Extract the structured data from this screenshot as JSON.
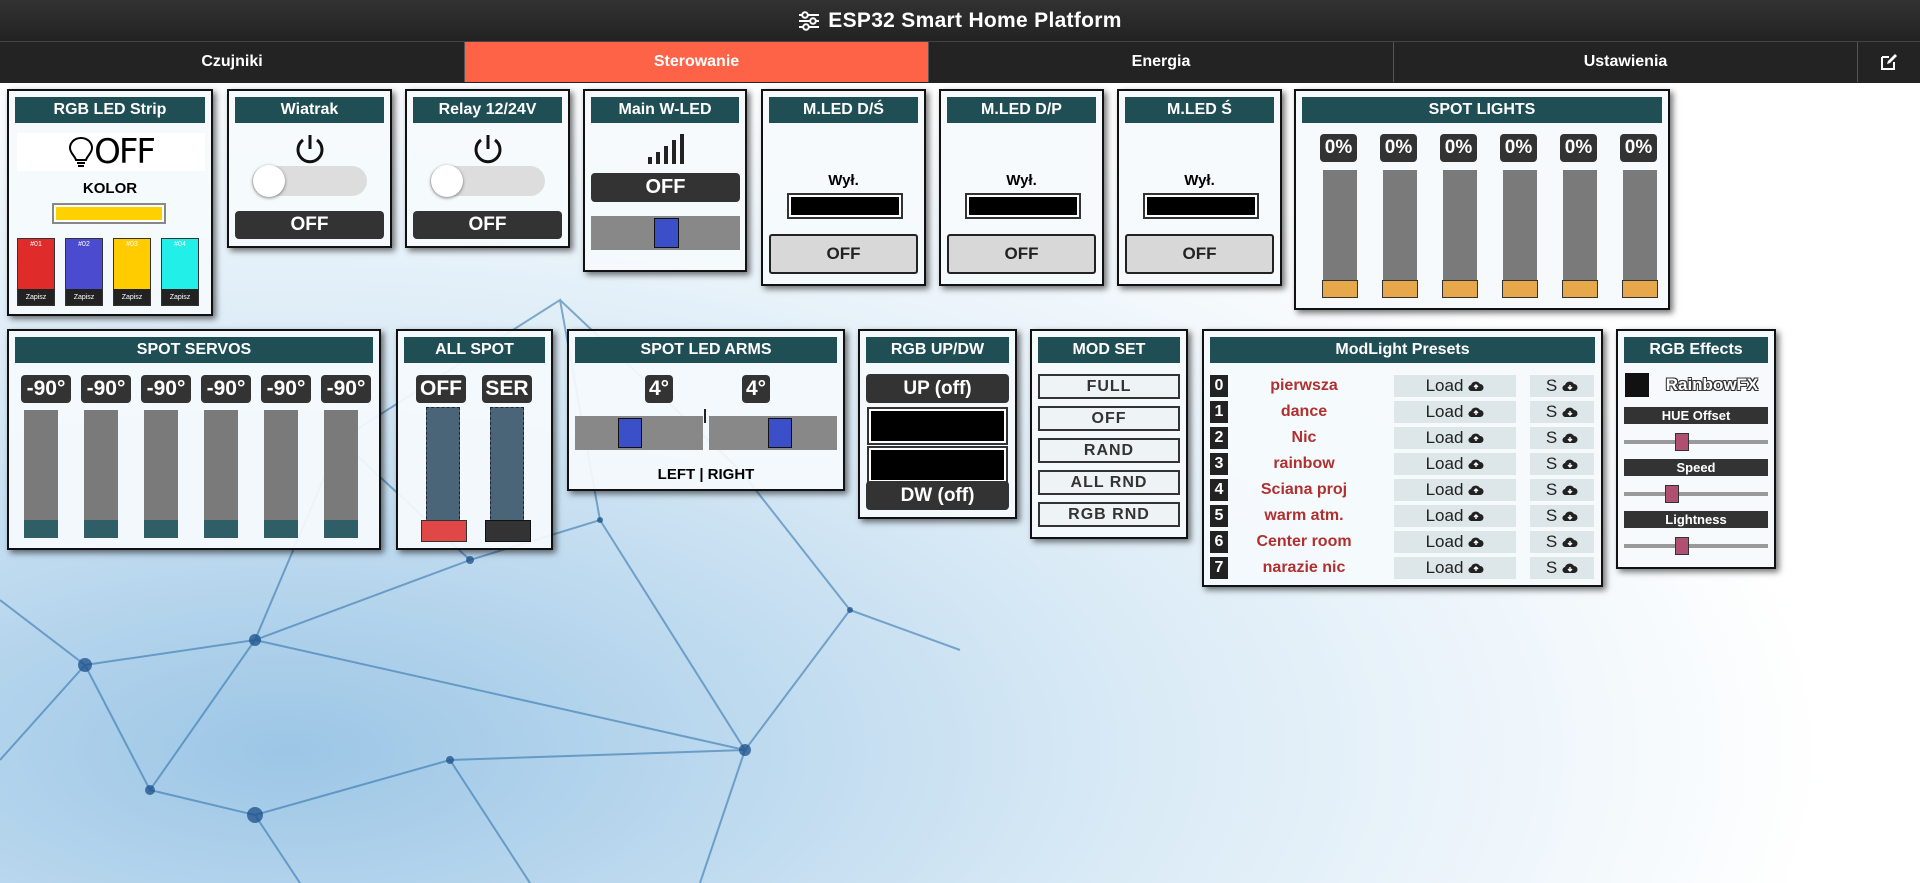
{
  "header": {
    "title": "ESP32 Smart Home Platform",
    "icon": "sliders-icon"
  },
  "nav": {
    "tabs": [
      "Czujniki",
      "Sterowanie",
      "Energia",
      "Ustawienia"
    ],
    "active": "Sterowanie",
    "edit_icon": "edit-icon"
  },
  "colors": {
    "accent": "#ff6347",
    "card_title": "#1f4e55",
    "header": "#2a2a2a"
  },
  "rgb_strip": {
    "title": "RGB LED Strip",
    "state": "OFF",
    "color_label": "KOLOR",
    "color_value": "#ffd000",
    "swatches": [
      {
        "name": "#01",
        "color": "#e02b2b",
        "label": "Zapisz"
      },
      {
        "name": "#02",
        "color": "#4b4bcf",
        "label": "Zapisz"
      },
      {
        "name": "#03",
        "color": "#ffcc00",
        "label": "Zapisz"
      },
      {
        "name": "#04",
        "color": "#22f0e8",
        "label": "Zapisz"
      }
    ]
  },
  "wiatrak": {
    "title": "Wiatrak",
    "state": "OFF"
  },
  "relay": {
    "title": "Relay 12/24V",
    "state": "OFF"
  },
  "main_wled": {
    "title": "Main W-LED",
    "state": "OFF",
    "slider_percent": 50
  },
  "mled_ds": {
    "title": "M.LED D/Ś",
    "label": "Wył.",
    "button": "OFF"
  },
  "mled_dp": {
    "title": "M.LED D/P",
    "label": "Wył.",
    "button": "OFF"
  },
  "mled_s": {
    "title": "M.LED Ś",
    "label": "Wył.",
    "button": "OFF"
  },
  "spot_lights": {
    "title": "SPOT LIGHTS",
    "values": [
      "0%",
      "0%",
      "0%",
      "0%",
      "0%",
      "0%"
    ]
  },
  "spot_servos": {
    "title": "SPOT SERVOS",
    "values": [
      "-90°",
      "-90°",
      "-90°",
      "-90°",
      "-90°",
      "-90°"
    ]
  },
  "all_spot": {
    "title": "ALL SPOT",
    "labels": [
      "OFF",
      "SER"
    ]
  },
  "spot_arms": {
    "title": "SPOT LED ARMS",
    "values": [
      "4°",
      "4°"
    ],
    "footer": "LEFT | RIGHT"
  },
  "rgb_updw": {
    "title": "RGB UP/DW",
    "up": "UP (off)",
    "dw": "DW (off)"
  },
  "mod_set": {
    "title": "MOD SET",
    "buttons": [
      "FULL",
      "OFF",
      "RAND",
      "ALL RND",
      "RGB RND"
    ]
  },
  "presets": {
    "title": "ModLight Presets",
    "load_label": "Load",
    "save_label": "S",
    "items": [
      {
        "num": "0",
        "name": "pierwsza"
      },
      {
        "num": "1",
        "name": "dance"
      },
      {
        "num": "2",
        "name": "Nic"
      },
      {
        "num": "3",
        "name": "rainbow"
      },
      {
        "num": "4",
        "name": "Sciana proj"
      },
      {
        "num": "5",
        "name": "warm atm."
      },
      {
        "num": "6",
        "name": "Center room"
      },
      {
        "num": "7",
        "name": "narazie nic"
      }
    ]
  },
  "rgb_effects": {
    "title": "RGB Effects",
    "effect": "RainbowFX",
    "sliders": [
      {
        "label": "HUE Offset",
        "percent": 40
      },
      {
        "label": "Speed",
        "percent": 33
      },
      {
        "label": "Lightness",
        "percent": 40
      }
    ]
  }
}
